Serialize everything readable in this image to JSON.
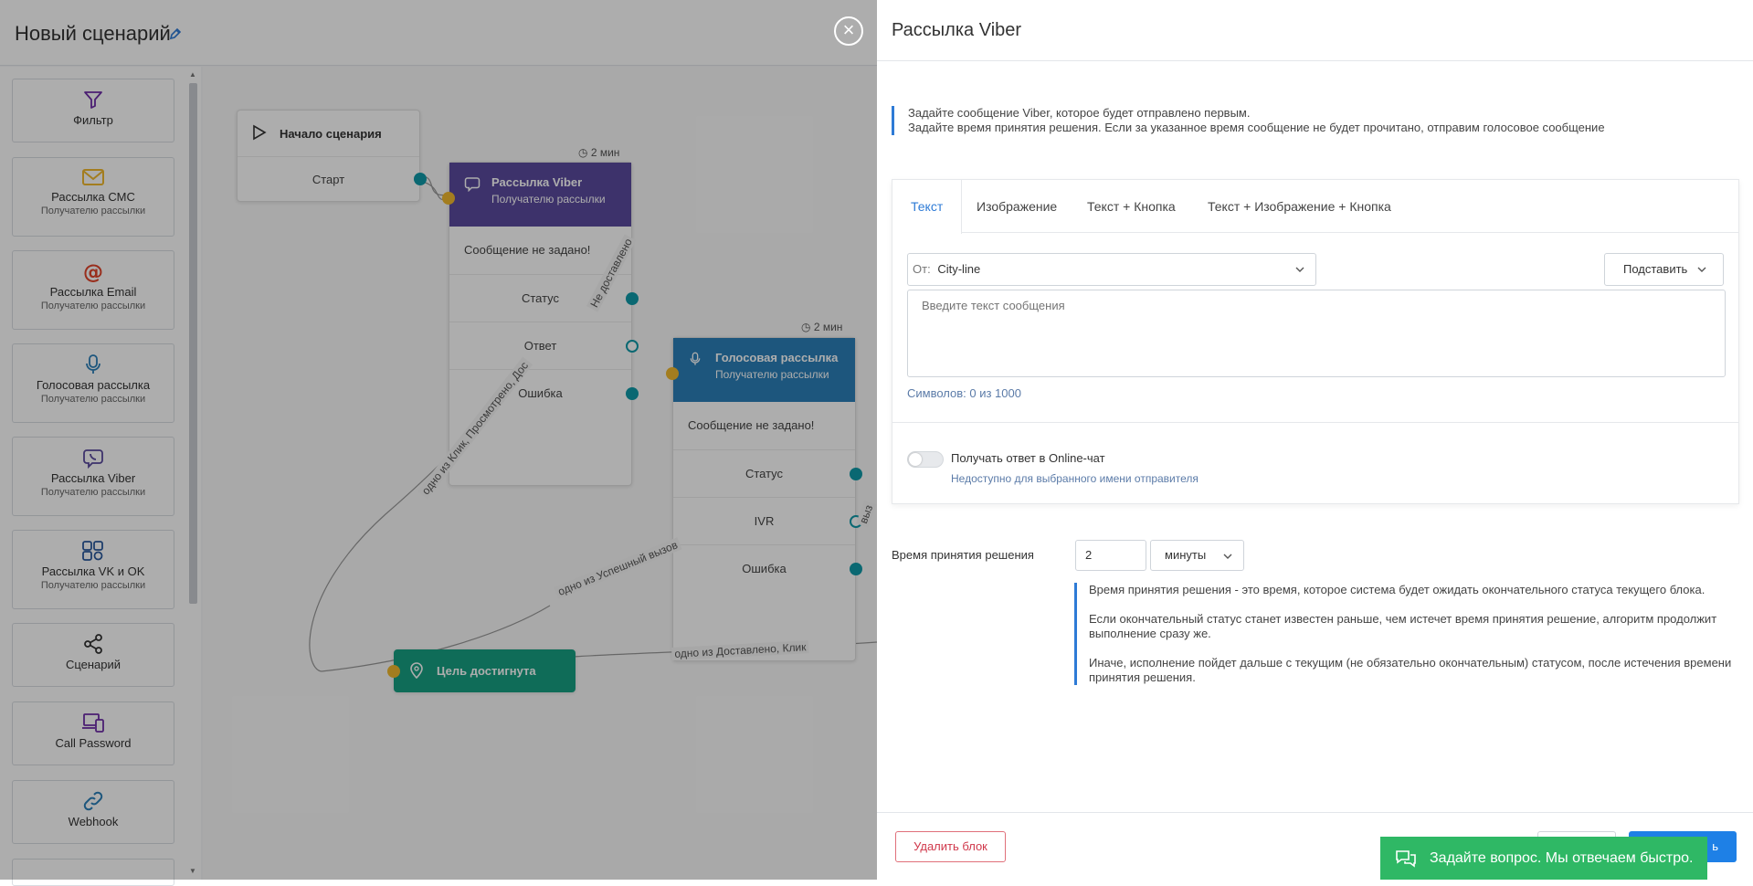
{
  "app": {
    "title": "Новый сценарий"
  },
  "sidebar": {
    "items": [
      {
        "title": "Фильтр",
        "sub": ""
      },
      {
        "title": "Рассылка СМС",
        "sub": "Получателю рассылки"
      },
      {
        "title": "Рассылка Email",
        "sub": "Получателю рассылки"
      },
      {
        "title": "Голосовая рассылка",
        "sub": "Получателю рассылки"
      },
      {
        "title": "Рассылка Viber",
        "sub": "Получателю рассылки"
      },
      {
        "title": "Рассылка VK и OK",
        "sub": "Получателю рассылки"
      },
      {
        "title": "Сценарий",
        "sub": ""
      },
      {
        "title": "Call Password",
        "sub": ""
      },
      {
        "title": "Webhook",
        "sub": ""
      }
    ]
  },
  "canvas": {
    "start": {
      "title": "Начало сценария",
      "port": "Старт"
    },
    "viber": {
      "timer": "2 мин",
      "title": "Рассылка Viber",
      "sub": "Получателю рассылки",
      "message": "Сообщение не задано!",
      "rows": [
        "Статус",
        "Ответ",
        "Ошибка"
      ]
    },
    "voice": {
      "timer": "2 мин",
      "title": "Голосовая рассылка",
      "sub": "Получателю рассылки",
      "message": "Сообщение не задано!",
      "rows": [
        "Статус",
        "IVR",
        "Ошибка"
      ]
    },
    "goal": {
      "title": "Цель достигнута"
    },
    "edges": {
      "e1": "одно из Клик, Просмотрено, Дос",
      "e2": "Не доставлено",
      "e3": "одно из Успешный вызов",
      "e4": "одно из Доставлено, Клик",
      "e5": "выз"
    }
  },
  "panel": {
    "title": "Рассылка Viber",
    "info": [
      "Задайте сообщение Viber, которое будет отправлено первым.",
      "Задайте время принятия решения. Если за указанное время сообщение не будет прочитано, отправим голосовое сообщение"
    ],
    "tabs": [
      "Текст",
      "Изображение",
      "Текст + Кнопка",
      "Текст + Изображение + Кнопка"
    ],
    "from_label": "От:",
    "from_value": "City-line",
    "substitute": "Подставить",
    "message_placeholder": "Введите текст сообщения",
    "chars": "Символов: 0 из 1000",
    "toggle_label": "Получать ответ в Online-чат",
    "toggle_sub": "Недоступно для выбранного имени отправителя",
    "decision_label": "Время принятия решения",
    "decision_value": "2",
    "decision_unit": "минуты",
    "help": [
      "Время принятия решения - это время, которое система будет ожидать окончательного статуса текущего блока.",
      "Если окончательный статус станет известен раньше, чем истечет время принятия решение, алгоритм продолжит выполнение сразу же.",
      "Иначе, исполнение пойдет дальше с текущим (не обязательно окончательным) статусом, после истечения времени принятия решения."
    ],
    "delete_button": "Удалить блок",
    "save_button": "ь"
  },
  "chat": {
    "label": "Задайте вопрос. Мы отвечаем быстро."
  },
  "colors": {
    "viber": "#5a4a9e",
    "voice": "#2b7fb8",
    "goal": "#17a082",
    "accent": "#1e80e6",
    "chat": "#2fb865",
    "danger": "#d0384b"
  }
}
